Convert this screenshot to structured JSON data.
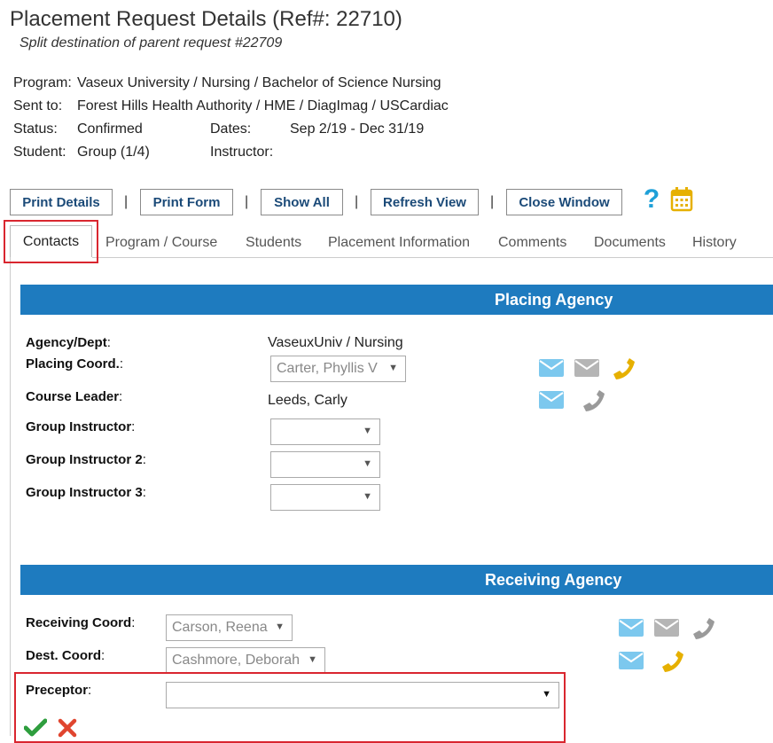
{
  "header": {
    "title": "Placement Request Details (Ref#: 22710)",
    "subtitle": "Split destination of parent request #22709"
  },
  "info": {
    "program_label": "Program:",
    "program_value": "Vaseux University / Nursing / Bachelor of Science Nursing",
    "sent_to_label": "Sent to:",
    "sent_to_value": "Forest Hills Health Authority / HME / DiagImag / USCardiac",
    "status_label": "Status:",
    "status_value": "Confirmed",
    "dates_label": "Dates:",
    "dates_value": "Sep 2/19 - Dec 31/19",
    "student_label": "Student:",
    "student_value": "Group (1/4)",
    "instructor_label": "Instructor:",
    "instructor_value": ""
  },
  "toolbar": {
    "print_details": "Print Details",
    "print_form": "Print Form",
    "show_all": "Show All",
    "refresh_view": "Refresh View",
    "close_window": "Close Window",
    "separator": "|",
    "help_icon": "question-mark-icon",
    "calendar_icon": "calendar-icon"
  },
  "tabs": [
    "Contacts",
    "Program / Course",
    "Students",
    "Placement Information",
    "Comments",
    "Documents",
    "History"
  ],
  "placing_agency": {
    "heading": "Placing Agency",
    "agency_label": "Agency/Dept",
    "agency_value": "VaseuxUniv / Nursing",
    "coord_label": "Placing Coord.",
    "coord_value": "Carter, Phyllis V",
    "leader_label": "Course Leader",
    "leader_value": "Leeds, Carly",
    "gi1_label": "Group Instructor",
    "gi2_label": "Group Instructor 2",
    "gi3_label": "Group Instructor 3"
  },
  "receiving_agency": {
    "heading": "Receiving Agency",
    "recv_coord_label": "Receiving Coord",
    "recv_coord_value": "Carson, Reena",
    "dest_coord_label": "Dest. Coord",
    "dest_coord_value": "Cashmore, Deborah",
    "preceptor_label": "Preceptor",
    "preceptor_value": ""
  },
  "colon": ":",
  "colors": {
    "section_blue": "#1e7bbf",
    "email_blue": "#7cc8ee",
    "email_gray": "#b5b5b5",
    "phone_gold": "#e6b000",
    "phone_gray": "#9a9a9a",
    "help_teal": "#1ea0d8",
    "check_green": "#2e9e3e",
    "cross_red": "#e0452f",
    "highlight_red": "#d9262f"
  }
}
